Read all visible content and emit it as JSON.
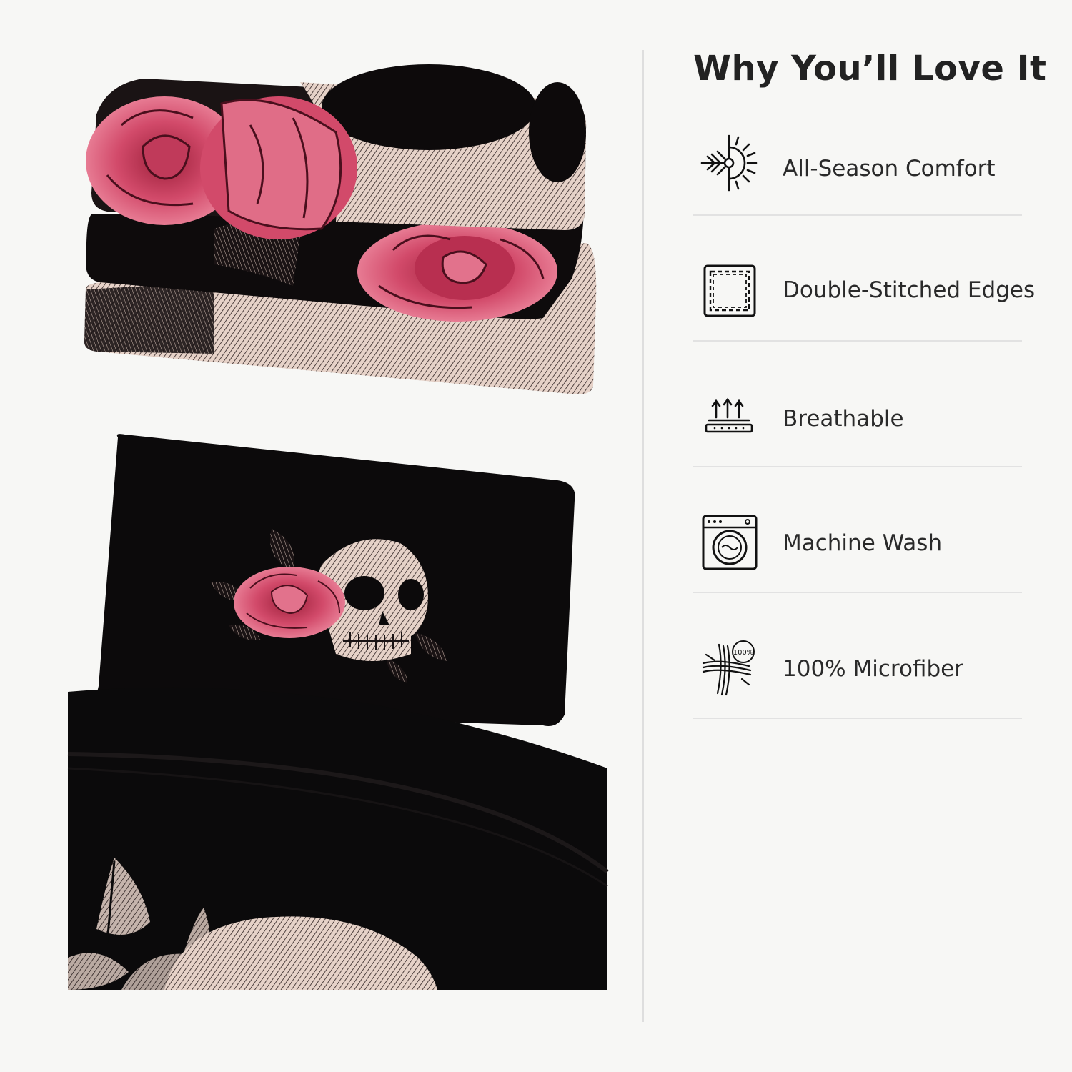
{
  "heading": "Why You’ll Love It",
  "features": [
    {
      "label": "All-Season Comfort",
      "icon": "sun-snow-icon"
    },
    {
      "label": "Double-Stitched Edges",
      "icon": "stitched-square-icon"
    },
    {
      "label": "Breathable",
      "icon": "breathable-arrows-icon"
    },
    {
      "label": "Machine Wash",
      "icon": "washing-machine-icon"
    },
    {
      "label": "100% Microfiber",
      "icon": "microfiber-icon",
      "badge": "100%"
    }
  ],
  "colors": {
    "background": "#f7f7f5",
    "fabric": "#0d0b0c",
    "rose": "#d24a6a",
    "bone": "#e8d3c8"
  }
}
